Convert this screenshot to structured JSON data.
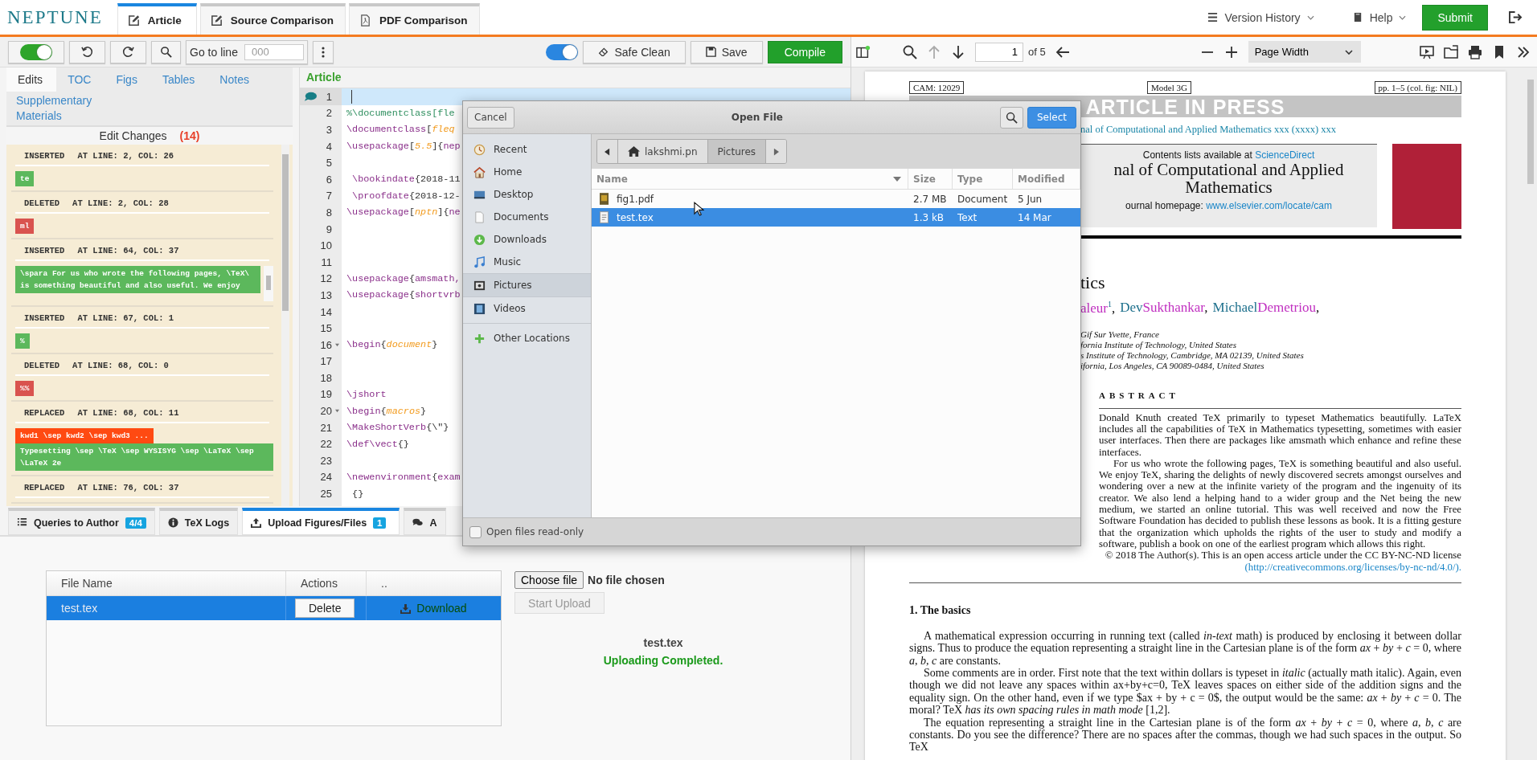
{
  "topbar": {
    "logo": "NEPTUNE",
    "tabs": [
      {
        "label": "Article",
        "kind": "editor",
        "selected": true
      },
      {
        "label": "Source Comparison",
        "kind": "editor",
        "selected": false
      },
      {
        "label": "PDF Comparison",
        "kind": "pdf",
        "selected": false
      }
    ],
    "menus": [
      {
        "label": "Version History",
        "kind": "history"
      },
      {
        "label": "Help",
        "kind": "help"
      }
    ],
    "submit": "Submit"
  },
  "toolbar": {
    "left_toggle_on": true,
    "goto_label": "Go to line",
    "goto_placeholder": "000",
    "right_toggle_on": true,
    "buttons": [
      {
        "label": "Safe Clean",
        "kind": "clean"
      },
      {
        "label": "Save",
        "kind": "save"
      },
      {
        "label": "Compile",
        "kind": "compile"
      }
    ]
  },
  "side_panel": {
    "tabs": [
      {
        "label": "Edits",
        "selected": true
      },
      {
        "label": "TOC",
        "selected": false
      },
      {
        "label": "Figs",
        "selected": false
      },
      {
        "label": "Tables",
        "selected": false
      },
      {
        "label": "Notes",
        "selected": false
      },
      {
        "label": "Supplementary Materials",
        "selected": false
      }
    ],
    "edit_changes": {
      "title": "Edit Changes",
      "count": "(14)",
      "items": [
        {
          "kind": "inserted",
          "action": "INSERTED",
          "location": "AT LINE: 2, COL: 26",
          "added": "te",
          "scrollable": false
        },
        {
          "kind": "deleted",
          "action": "DELETED",
          "location": "AT LINE: 2, COL: 28",
          "removed": "ml",
          "scrollable": false
        },
        {
          "kind": "inserted",
          "action": "INSERTED",
          "location": "AT LINE: 64, COL: 37",
          "added": "\\spara For us who wrote the following pages, \\TeX\\ is something beautiful and also useful. We enjoy",
          "scrollable": true
        },
        {
          "kind": "inserted",
          "action": "INSERTED",
          "location": "AT LINE: 67, COL: 1",
          "added": "%",
          "scrollable": false
        },
        {
          "kind": "deleted",
          "action": "DELETED",
          "location": "AT LINE: 68, COL: 0",
          "removed": "%%",
          "scrollable": false
        },
        {
          "kind": "replaced",
          "action": "REPLACED",
          "location": "AT LINE: 68, COL: 11",
          "removed": "kwd1 \\sep kwd2 \\sep kwd3 ...",
          "added": "Typesetting \\sep \\TeX \\sep WYSISYG \\sep \\LaTeX \\sep \\LaTeX 2e",
          "scrollable": false
        },
        {
          "action": "REPLACED",
          "location": "AT LINE: 76, COL: 37",
          "scrollable": false
        }
      ]
    }
  },
  "editor": {
    "title": "Article",
    "lines": [
      {
        "number": "1",
        "active": true,
        "note": true,
        "foldable": false
      },
      {
        "number": "2",
        "active": false,
        "note": false,
        "foldable": false,
        "segments": [
          {
            "kind": "comment",
            "text": "%\\documentclass[fle"
          }
        ]
      },
      {
        "number": "3",
        "active": false,
        "note": false,
        "foldable": false,
        "segments": [
          {
            "kind": "cmd",
            "text": "\\documentclass"
          },
          {
            "kind": "plain",
            "text": "["
          },
          {
            "kind": "opt",
            "text": "fleq"
          }
        ]
      },
      {
        "number": "4",
        "active": false,
        "note": false,
        "foldable": false,
        "segments": [
          {
            "kind": "cmd",
            "text": "\\usepackage"
          },
          {
            "kind": "plain",
            "text": "["
          },
          {
            "kind": "opt",
            "text": "5.5"
          },
          {
            "kind": "plain",
            "text": "]{"
          },
          {
            "kind": "cmd",
            "text": "nep"
          }
        ]
      },
      {
        "number": "5",
        "active": false,
        "note": false,
        "foldable": false
      },
      {
        "number": "6",
        "active": false,
        "note": false,
        "foldable": false,
        "segments": [
          {
            "kind": "cmd",
            "text": " \\bookindate"
          },
          {
            "kind": "plain",
            "text": "{2018-11"
          }
        ]
      },
      {
        "number": "7",
        "active": false,
        "note": false,
        "foldable": false,
        "segments": [
          {
            "kind": "cmd",
            "text": " \\proofdate"
          },
          {
            "kind": "plain",
            "text": "{2018-12-"
          }
        ]
      },
      {
        "number": "8",
        "active": false,
        "note": false,
        "foldable": false,
        "segments": [
          {
            "kind": "cmd",
            "text": "\\usepackage"
          },
          {
            "kind": "plain",
            "text": "["
          },
          {
            "kind": "opt",
            "text": "nptn"
          },
          {
            "kind": "plain",
            "text": "]{"
          },
          {
            "kind": "cmd",
            "text": "ne"
          }
        ]
      },
      {
        "number": "9",
        "active": false,
        "note": false,
        "foldable": false
      },
      {
        "number": "10",
        "active": false,
        "note": false,
        "foldable": false
      },
      {
        "number": "11",
        "active": false,
        "note": false,
        "foldable": false
      },
      {
        "number": "12",
        "active": false,
        "note": false,
        "foldable": false,
        "segments": [
          {
            "kind": "cmd",
            "text": "\\usepackage"
          },
          {
            "kind": "plain",
            "text": "{"
          },
          {
            "kind": "cmd",
            "text": "amsmath,"
          }
        ]
      },
      {
        "number": "13",
        "active": false,
        "note": false,
        "foldable": false,
        "segments": [
          {
            "kind": "cmd",
            "text": "\\usepackage"
          },
          {
            "kind": "plain",
            "text": "{"
          },
          {
            "kind": "cmd",
            "text": "shortvrb"
          }
        ]
      },
      {
        "number": "14",
        "active": false,
        "note": false,
        "foldable": false
      },
      {
        "number": "15",
        "active": false,
        "note": false,
        "foldable": false
      },
      {
        "number": "16",
        "active": false,
        "note": false,
        "foldable": true,
        "segments": [
          {
            "kind": "cmd",
            "text": "\\begin"
          },
          {
            "kind": "plain",
            "text": "{"
          },
          {
            "kind": "opt",
            "text": "document"
          },
          {
            "kind": "plain",
            "text": "}"
          }
        ]
      },
      {
        "number": "17",
        "active": false,
        "note": false,
        "foldable": false
      },
      {
        "number": "18",
        "active": false,
        "note": false,
        "foldable": false
      },
      {
        "number": "19",
        "active": false,
        "note": false,
        "foldable": false,
        "segments": [
          {
            "kind": "cmd",
            "text": "\\jshort"
          }
        ]
      },
      {
        "number": "20",
        "active": false,
        "note": false,
        "foldable": true,
        "segments": [
          {
            "kind": "cmd",
            "text": "\\begin"
          },
          {
            "kind": "plain",
            "text": "{"
          },
          {
            "kind": "opt",
            "text": "macros"
          },
          {
            "kind": "plain",
            "text": "}"
          }
        ]
      },
      {
        "number": "21",
        "active": false,
        "note": false,
        "foldable": false,
        "segments": [
          {
            "kind": "cmd",
            "text": "\\MakeShortVerb"
          },
          {
            "kind": "plain",
            "text": "{\\\"}"
          }
        ]
      },
      {
        "number": "22",
        "active": false,
        "note": false,
        "foldable": false,
        "segments": [
          {
            "kind": "cmd",
            "text": "\\def\\vect"
          },
          {
            "kind": "plain",
            "text": "{}"
          }
        ]
      },
      {
        "number": "23",
        "active": false,
        "note": false,
        "foldable": false
      },
      {
        "number": "24",
        "active": false,
        "note": false,
        "foldable": false,
        "segments": [
          {
            "kind": "cmd",
            "text": "\\newenvironment"
          },
          {
            "kind": "plain",
            "text": "{"
          },
          {
            "kind": "cmd",
            "text": "exam"
          }
        ]
      },
      {
        "number": "25",
        "active": false,
        "note": false,
        "foldable": false,
        "segments": [
          {
            "kind": "plain",
            "text": " {}"
          }
        ]
      }
    ]
  },
  "bottom_tabs": [
    {
      "label": "Queries to Author",
      "kind": "queries",
      "badge": "4/4",
      "selected": false
    },
    {
      "label": "TeX Logs",
      "kind": "logs",
      "selected": false
    },
    {
      "label": "Upload Figures/Files",
      "kind": "upload",
      "badge": "1",
      "selected": true
    },
    {
      "label": "A",
      "kind": "comments",
      "selected": false
    }
  ],
  "upload": {
    "columns": [
      "File Name",
      "Actions",
      ".."
    ],
    "rows": [
      {
        "name": "test.tex",
        "action": "Delete",
        "download": "Download",
        "selected": true
      }
    ],
    "choose_button": "Choose file",
    "choose_status": "No file chosen",
    "start_upload": {
      "label": "Start Upload",
      "disabled": true
    },
    "status_file": "test.tex",
    "status_message": "Uploading Completed."
  },
  "pdf_viewer": {
    "toolbar": {
      "page": "1",
      "page_count": "of 5",
      "zoom": "Page Width"
    },
    "page": {
      "header_boxes": [
        "CAM: 12029",
        "Model 3G",
        "pp. 1–5 (col. fig: NIL)"
      ],
      "banner": "ARTICLE IN PRESS",
      "journal_line": "nal of Computational and Applied Mathematics xxx (xxxx) xxx",
      "masthead": {
        "contents": "Contents lists available at",
        "contents_link": "ScienceDirect",
        "title_lines": [
          "nal of Computational and Applied",
          "Mathematics"
        ],
        "homepage": "ournal homepage:",
        "homepage_link": "www.elsevier.com/locate/cam"
      },
      "title": "tics",
      "authors": [
        {
          "family": "aleur",
          "mark": "1",
          "sep": ","
        },
        {
          "given": "Dev",
          "family": "Sukthankar",
          "sep": ","
        },
        {
          "given": "Michael",
          "family": "Demetriou",
          "sep": ","
        }
      ],
      "affiliations": [
        "Gif Sur Yvette, France",
        "fornia Institute of Technology, United States",
        "s Institute of Technology, Cambridge, MA 02139, United States",
        "ifornia, Los Angeles, CA 90089-0484, United States"
      ],
      "abstract_heading": "ABSTRACT",
      "abstract": [
        "Donald Knuth created TeX primarily to typeset Mathematics beautifully. LaTeX includes all the capabilities of TeX in Mathematics typesetting, sometimes with easier user interfaces. Then there are packages like amsmath which enhance and refine these interfaces.",
        "For us who wrote the following pages, TeX is something beautiful and also useful. We enjoy TeX, sharing the delights of newly discovered secrets amongst ourselves and wondering over a new at the infinite variety of the program and the ingenuity of its creator. We also lend a helping hand to a wider group and the Net being the new medium, we started an online tutorial. This was well received and now the Free Software Foundation has decided to publish these lessons as book. It is a fitting gesture that the organization which upholds the rights of the user to study and modify a software, publish a book on one of the earliest program which allows this right."
      ],
      "license": "© 2018 The Author(s). This is an open access article under the CC BY-NC-ND license",
      "license_link": "(http://creativecommons.org/licenses/by-nc-nd/4.0/).",
      "section": "1. The basics",
      "paragraphs": [
        "A mathematical expression occurring in running text (called *in-text* math) is produced by enclosing it between dollar signs. Thus to produce the equation representing a straight line in the Cartesian plane is of the form *ax* + *by* + *c* = 0, where *a*, *b*, *c* are constants.",
        "Some comments are in order. First note that the text within dollars is typeset in *italic* (actually math italic). Again, even though we did not leave any spaces within ax+by+c=0, TeX leaves spaces on either side of the addition signs and the equality sign. On the other hand, even if we type $ax + by + c = 0$, the output would be the same: *ax* + *by* + *c* = 0. The moral? TeX *has its own spacing rules in math mode* [1,2].",
        "The equation representing a straight line in the Cartesian plane is of the form *ax* + *by* + *c* = 0, where *a*, *b*, *c* are constants. Do you see the difference? There are no spaces after the commas, though we had such spaces in the output. So TeX"
      ]
    }
  },
  "open_file_dialog": {
    "cancel": "Cancel",
    "title": "Open File",
    "confirm": "Select",
    "places": [
      {
        "label": "Recent",
        "kind": "recent",
        "selected": false
      },
      {
        "label": "Home",
        "kind": "home",
        "selected": false
      },
      {
        "label": "Desktop",
        "kind": "desktop",
        "selected": false
      },
      {
        "label": "Documents",
        "kind": "documents",
        "selected": false
      },
      {
        "label": "Downloads",
        "kind": "downloads",
        "selected": false
      },
      {
        "label": "Music",
        "kind": "music",
        "selected": false
      },
      {
        "label": "Pictures",
        "kind": "pictures",
        "selected": true
      },
      {
        "label": "Videos",
        "kind": "videos",
        "selected": false
      }
    ],
    "other_locations": "Other Locations",
    "path": [
      {
        "label": "lakshmi.pn",
        "kind": "home",
        "selected": false
      },
      {
        "label": "Pictures",
        "kind": "folder",
        "selected": true
      }
    ],
    "columns": [
      "Name",
      "Size",
      "Type",
      "Modified"
    ],
    "files": [
      {
        "name": "fig1.pdf",
        "kind": "pdf",
        "size": "2.7 MB",
        "type": "Document",
        "modified": "5 Jun",
        "selected": false
      },
      {
        "name": "test.tex",
        "kind": "text",
        "size": "1.3 kB",
        "type": "Text",
        "modified": "14 Mar",
        "selected": true
      }
    ],
    "read_only": {
      "label": "Open files read-only",
      "checked": false
    }
  }
}
